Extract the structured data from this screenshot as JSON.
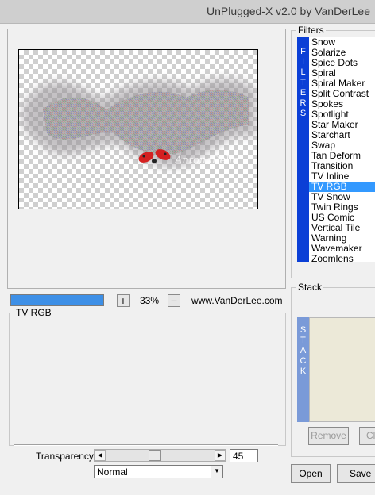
{
  "window": {
    "title": "UnPlugged-X v2.0 by VanDerLee"
  },
  "preview": {
    "watermark": "AntonaBelle"
  },
  "zoom": {
    "plus_label": "+",
    "value": "33%",
    "minus_label": "−",
    "progress": 1.0
  },
  "website": "www.VanDerLee.com",
  "settings": {
    "group_title": "TV RGB",
    "transparency_label": "Transparency",
    "transparency_value": "45",
    "transparency_fraction": 0.45,
    "blend_mode": "Normal"
  },
  "filters": {
    "group_title": "Filters",
    "strip_letters": [
      "F",
      "I",
      "L",
      "T",
      "E",
      "R",
      "S"
    ],
    "items": [
      "Snow",
      "Solarize",
      "Spice Dots",
      "Spiral",
      "Spiral Maker",
      "Split Contrast",
      "Spokes",
      "Spotlight",
      "Star Maker",
      "Starchart",
      "Swap",
      "Tan Deform",
      "Transition",
      "TV Inline",
      "TV RGB",
      "TV Snow",
      "Twin Rings",
      "US Comic",
      "Vertical Tile",
      "Warning",
      "Wavemaker",
      "Zoomlens"
    ],
    "selected": "TV RGB"
  },
  "stack": {
    "group_title": "Stack",
    "strip_letters": [
      "S",
      "T",
      "A",
      "C",
      "K"
    ],
    "remove_label": "Remove",
    "clear_label": "Cl"
  },
  "buttons": {
    "open": "Open",
    "save": "Save"
  },
  "colors": {
    "strip_blue": "#0b3fd6",
    "selected": "#3399ff",
    "progress": "#3d8fe6"
  }
}
